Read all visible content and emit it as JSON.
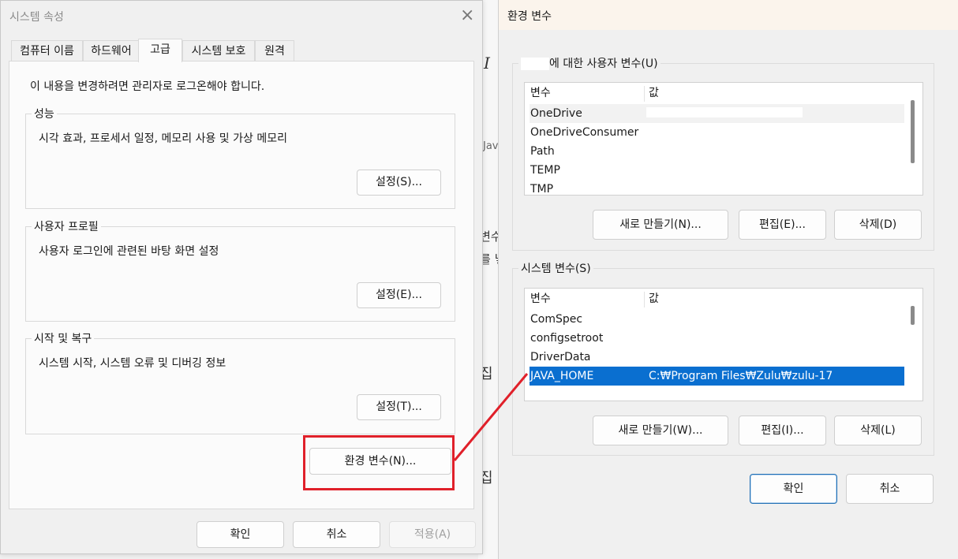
{
  "colors": {
    "highlight": "#e0202a",
    "selection": "#0a6fd0"
  },
  "system_properties": {
    "title": "시스템 속성",
    "close_icon": "×",
    "tabs": [
      "컴퓨터 이름",
      "하드웨어",
      "고급",
      "시스템 보호",
      "원격"
    ],
    "active_tab": "고급",
    "admin_note": "이 내용을 변경하려면 관리자로 로그온해야 합니다.",
    "performance": {
      "label": "성능",
      "desc": "시각 효과, 프로세서 일정, 메모리 사용 및 가상 메모리",
      "button": "설정(S)..."
    },
    "user_profile": {
      "label": "사용자 프로필",
      "desc": "사용자 로그인에 관련된 바탕 화면 설정",
      "button": "설정(E)..."
    },
    "startup_recovery": {
      "label": "시작 및 복구",
      "desc": "시스템 시작, 시스템 오류 및 디버깅 정보",
      "button": "설정(T)..."
    },
    "env_button": "환경 변수(N)...",
    "ok": "확인",
    "cancel": "취소",
    "apply": "적용(A)"
  },
  "background_fragments": {
    "italic_i": "I",
    "jav": "Jav",
    "byeon_su": "변수",
    "reul_b": "를 넣",
    "jip1": "집",
    "jip2": "집"
  },
  "env_vars": {
    "title": "환경 변수",
    "user_group_label": "에 대한 사용자 변수(U)",
    "col_var": "변수",
    "col_val": "값",
    "user_vars": [
      {
        "name": "OneDrive",
        "value": ""
      },
      {
        "name": "OneDriveConsumer",
        "value": ""
      },
      {
        "name": "Path",
        "value": ""
      },
      {
        "name": "TEMP",
        "value": ""
      },
      {
        "name": "TMP",
        "value": ""
      }
    ],
    "user_buttons": {
      "new": "새로 만들기(N)...",
      "edit": "편집(E)...",
      "delete": "삭제(D)"
    },
    "system_group_label": "시스템 변수(S)",
    "system_vars": [
      {
        "name": "ComSpec",
        "value": ""
      },
      {
        "name": "configsetroot",
        "value": ""
      },
      {
        "name": "DriverData",
        "value": ""
      },
      {
        "name": "JAVA_HOME",
        "value": "C:₩Program Files₩Zulu₩zulu-17"
      }
    ],
    "selected_system_var": "JAVA_HOME",
    "system_buttons": {
      "new": "새로 만들기(W)...",
      "edit": "편집(I)...",
      "delete": "삭제(L)"
    },
    "ok": "확인",
    "cancel": "취소"
  }
}
